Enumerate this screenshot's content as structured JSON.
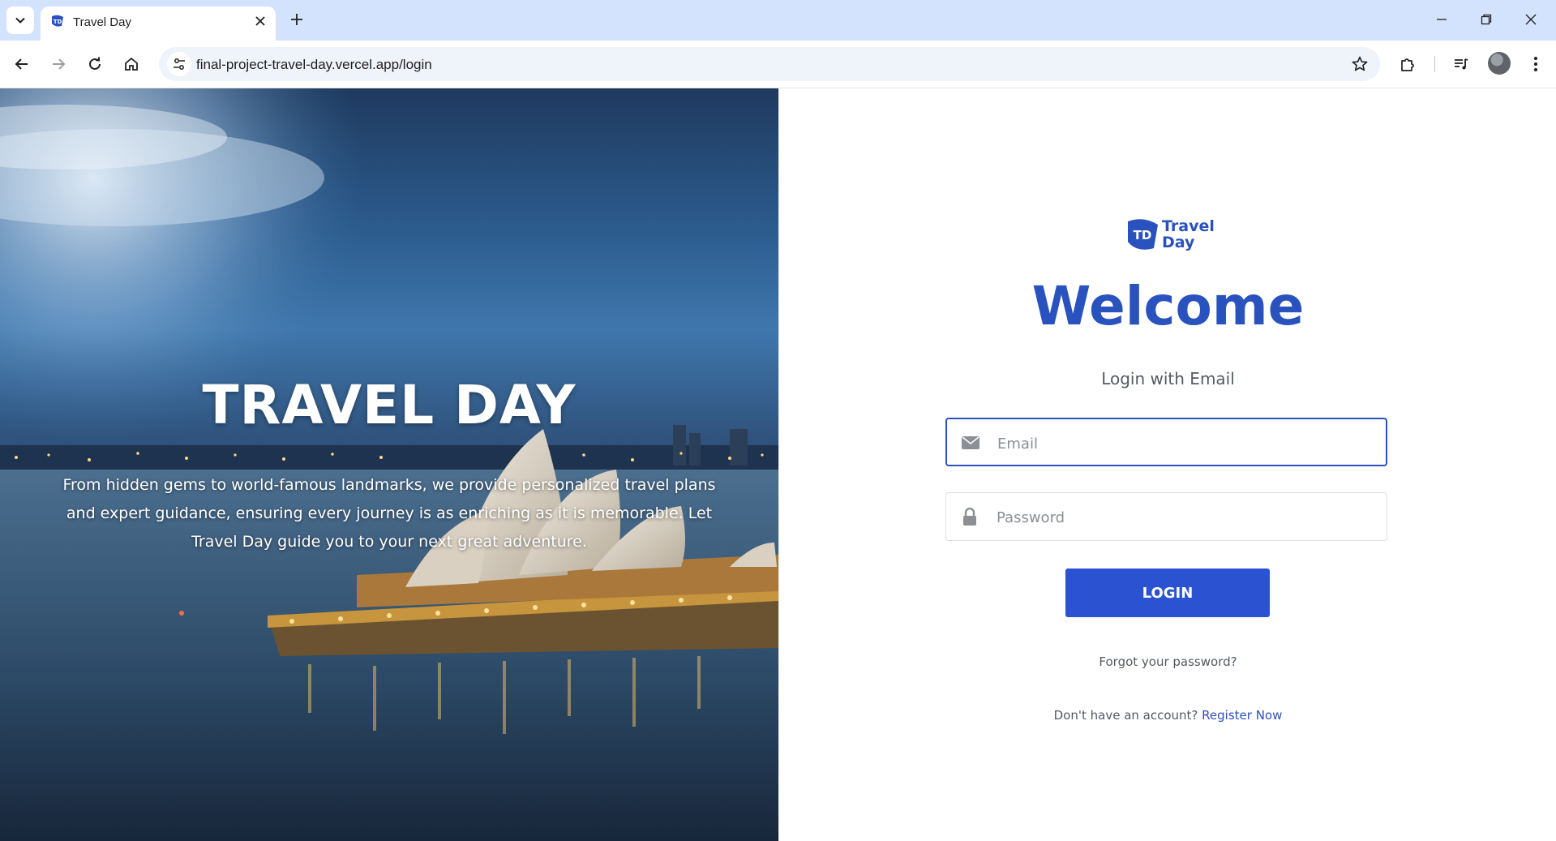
{
  "browser": {
    "tab_title": "Travel Day",
    "url": "final-project-travel-day.vercel.app/login"
  },
  "hero": {
    "title": "TRAVEL DAY",
    "description": "From hidden gems to world-famous landmarks, we provide personalized travel plans and expert guidance, ensuring every journey is as enriching as it is memorable. Let Travel Day guide you to your next great adventure."
  },
  "brand": {
    "mark_text": "TD",
    "name_line1": "Travel",
    "name_line2": "Day",
    "color": "#2a52be"
  },
  "login": {
    "heading": "Welcome",
    "subtitle": "Login with Email",
    "email_placeholder": "Email",
    "password_placeholder": "Password",
    "button_label": "LOGIN",
    "forgot_label": "Forgot your password?",
    "register_prompt": "Don't have an account?",
    "register_link": "Register Now"
  },
  "icons": {
    "tab_search": "chevron-down-icon",
    "email": "envelope-icon",
    "password": "lock-icon"
  }
}
